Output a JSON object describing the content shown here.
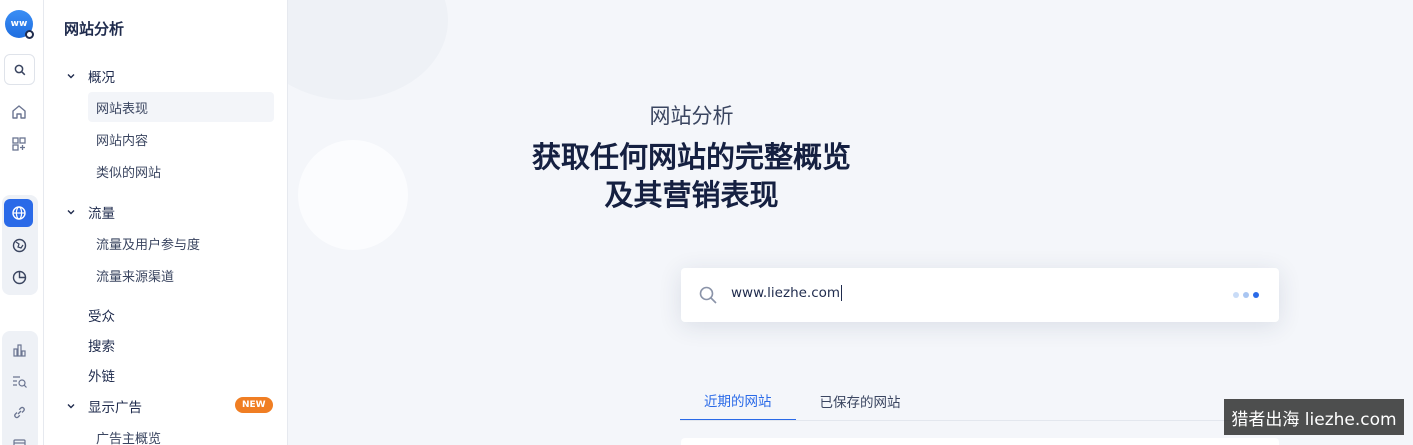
{
  "rail": {
    "logo_text": "ww",
    "icons": [
      "search-icon",
      "home-icon",
      "apps-icon",
      "globe-icon",
      "market-globe-icon",
      "pie-chart-icon",
      "bar-chart-icon",
      "keyword-search-icon",
      "link-icon",
      "ads-icon"
    ],
    "accent": "#2a6ae8"
  },
  "nav": {
    "title": "网站分析",
    "overview": {
      "label": "概况",
      "items": [
        "网站表现",
        "网站内容",
        "类似的网站"
      ]
    },
    "traffic": {
      "label": "流量",
      "items": [
        "流量及用户参与度",
        "流量来源渠道"
      ]
    },
    "audience": "受众",
    "search": "搜索",
    "backlinks": "外链",
    "display_ads": {
      "label": "显示广告",
      "badge": "NEW",
      "items": [
        "广告主概览"
      ]
    }
  },
  "main": {
    "title": "网站分析",
    "headline_line1": "获取任何网站的完整概览",
    "headline_line2": "及其营销表现",
    "search": {
      "value": "www.liezhe.com"
    },
    "tabs": [
      "近期的网站",
      "已保存的网站"
    ]
  },
  "watermark": "猎者出海 liezhe.com",
  "colors": {
    "badge": "#f07e23",
    "dots": [
      "#c9dcf7",
      "#a9c6f2",
      "#2a6ae8"
    ]
  }
}
